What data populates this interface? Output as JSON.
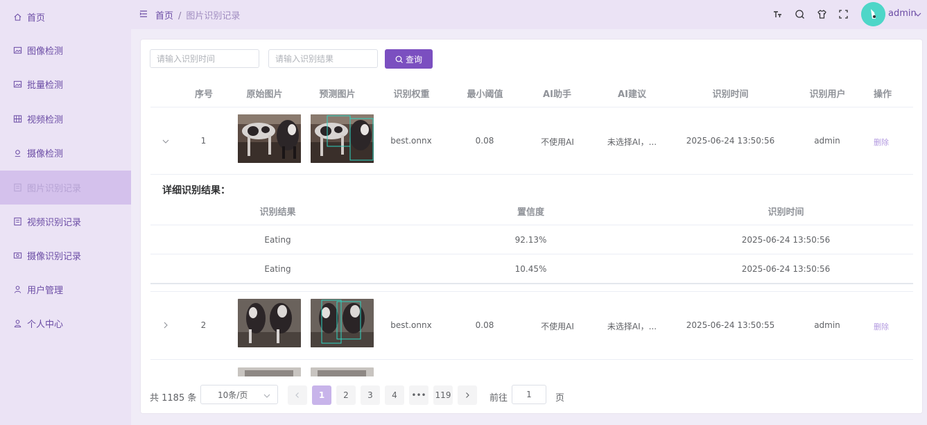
{
  "sidebar": {
    "items": [
      {
        "label": "首页",
        "icon": "home-icon"
      },
      {
        "label": "图像检测",
        "icon": "image-icon"
      },
      {
        "label": "批量检测",
        "icon": "images-icon"
      },
      {
        "label": "视频检测",
        "icon": "video-icon"
      },
      {
        "label": "摄像检测",
        "icon": "camera-icon"
      },
      {
        "label": "图片识别记录",
        "icon": "record-icon",
        "active": true
      },
      {
        "label": "视频识别记录",
        "icon": "video-record-icon"
      },
      {
        "label": "摄像识别记录",
        "icon": "camera-record-icon"
      },
      {
        "label": "用户管理",
        "icon": "users-icon"
      },
      {
        "label": "个人中心",
        "icon": "user-icon"
      }
    ]
  },
  "header": {
    "breadcrumb": {
      "home": "首页",
      "separator": "/",
      "current": "图片识别记录"
    },
    "username": "admin"
  },
  "search": {
    "time_placeholder": "请输入识别时间",
    "result_placeholder": "请输入识别结果",
    "query_label": "查询"
  },
  "table": {
    "columns": [
      "序号",
      "原始图片",
      "预测图片",
      "识别权重",
      "最小阈值",
      "AI助手",
      "AI建议",
      "识别时间",
      "识别用户",
      "操作"
    ],
    "rows": [
      {
        "index": "1",
        "weight": "best.onnx",
        "threshold": "0.08",
        "ai": "不使用AI",
        "suggestion": "未选择AI，...",
        "time": "2025-06-24 13:50:56",
        "user": "admin",
        "action": "删除",
        "expanded": true
      },
      {
        "index": "2",
        "weight": "best.onnx",
        "threshold": "0.08",
        "ai": "不使用AI",
        "suggestion": "未选择AI，...",
        "time": "2025-06-24 13:50:55",
        "user": "admin",
        "action": "删除",
        "expanded": false
      }
    ],
    "detail": {
      "title": "详细识别结果：",
      "columns": [
        "识别结果",
        "置信度",
        "识别时间"
      ],
      "rows": [
        {
          "result": "Eating",
          "confidence": "92.13%",
          "time": "2025-06-24 13:50:56"
        },
        {
          "result": "Eating",
          "confidence": "10.45%",
          "time": "2025-06-24 13:50:56"
        }
      ]
    }
  },
  "pagination": {
    "total": "共 1185 条",
    "page_size": "10条/页",
    "pages": [
      "1",
      "2",
      "3",
      "4",
      "•••",
      "119"
    ],
    "current": "1",
    "goto_label": "前往",
    "goto_value": "1",
    "goto_suffix": "页"
  },
  "colors": {
    "accent": "#7b4fc0",
    "sidebar_bg": "#ebe3f5",
    "active_bg": "#d4c1ec",
    "avatar_bg": "#4ed6c8"
  }
}
